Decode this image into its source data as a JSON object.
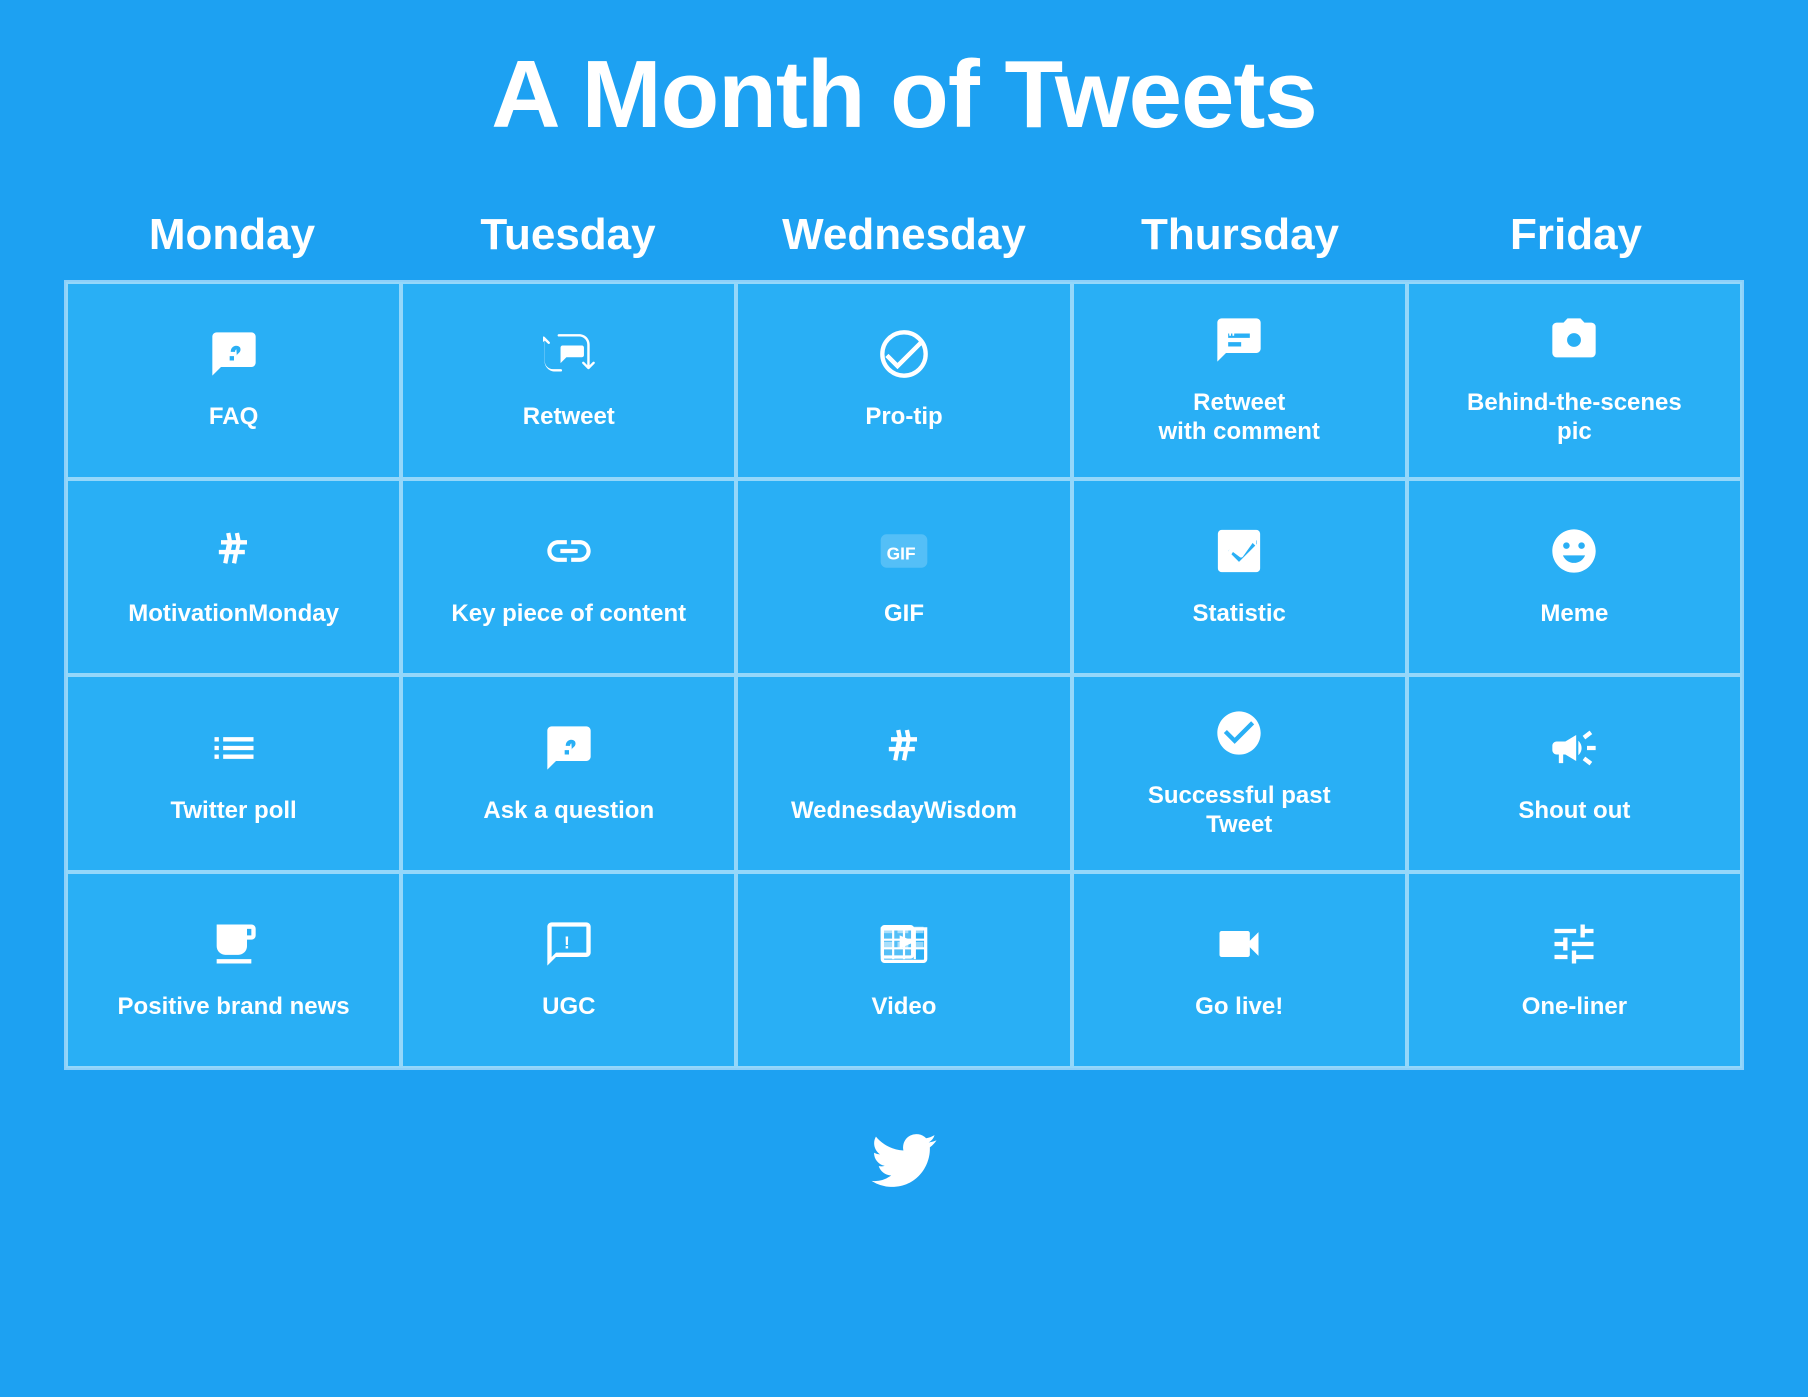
{
  "title": "A Month of Tweets",
  "days": [
    {
      "label": "Monday"
    },
    {
      "label": "Tuesday"
    },
    {
      "label": "Wednesday"
    },
    {
      "label": "Thursday"
    },
    {
      "label": "Friday"
    }
  ],
  "rows": [
    [
      {
        "icon": "faq",
        "label": "FAQ"
      },
      {
        "icon": "retweet",
        "label": "Retweet"
      },
      {
        "icon": "protip",
        "label": "Pro-tip"
      },
      {
        "icon": "retweet-comment",
        "label": "Retweet\nwith comment"
      },
      {
        "icon": "camera",
        "label": "Behind-the-scenes\npic"
      }
    ],
    [
      {
        "icon": "hashtag",
        "label": "MotivationMonday"
      },
      {
        "icon": "link",
        "label": "Key piece of content"
      },
      {
        "icon": "gif",
        "label": "GIF"
      },
      {
        "icon": "statistic",
        "label": "Statistic"
      },
      {
        "icon": "meme",
        "label": "Meme"
      }
    ],
    [
      {
        "icon": "poll",
        "label": "Twitter poll"
      },
      {
        "icon": "question",
        "label": "Ask a question"
      },
      {
        "icon": "hashtag2",
        "label": "WednesdayWisdom"
      },
      {
        "icon": "check",
        "label": "Successful past\nTweet"
      },
      {
        "icon": "shoutout",
        "label": "Shout out"
      }
    ],
    [
      {
        "icon": "news",
        "label": "Positive brand news"
      },
      {
        "icon": "ugc",
        "label": "UGC"
      },
      {
        "icon": "video",
        "label": "Video"
      },
      {
        "icon": "live",
        "label": "Go live!"
      },
      {
        "icon": "oneliner",
        "label": "One-liner"
      }
    ]
  ]
}
